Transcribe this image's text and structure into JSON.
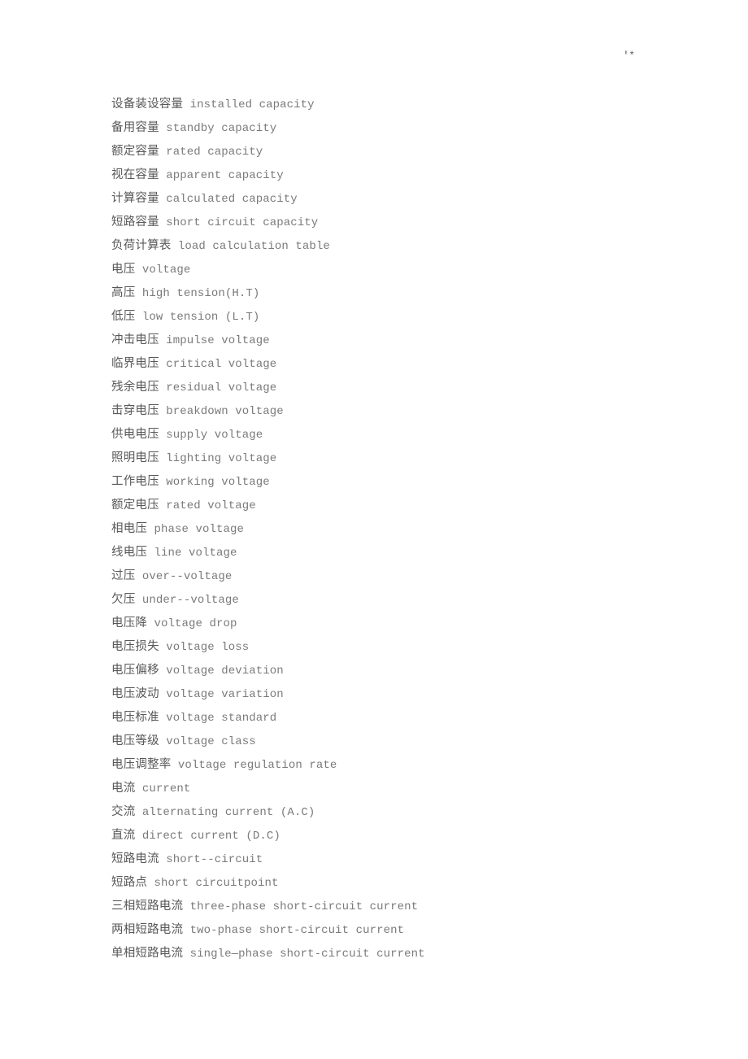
{
  "page": {
    "background_color": "#ffffff",
    "text_color": "#6b6b6b",
    "term_color": "#585858",
    "gloss_color": "#7a7a7a",
    "corner_mark": "'*"
  },
  "glossary": {
    "entries": [
      {
        "term": "设备装设容量",
        "gloss": "installed capacity"
      },
      {
        "term": "备用容量",
        "gloss": "standby capacity"
      },
      {
        "term": "额定容量",
        "gloss": "rated capacity"
      },
      {
        "term": "视在容量",
        "gloss": "apparent capacity"
      },
      {
        "term": "计算容量",
        "gloss": "calculated capacity"
      },
      {
        "term": "短路容量",
        "gloss": "short circuit capacity"
      },
      {
        "term": "负荷计算表",
        "gloss": "load calculation table"
      },
      {
        "term": "电压",
        "gloss": "voltage"
      },
      {
        "term": "高压",
        "gloss": "high tension(H.T)"
      },
      {
        "term": "低压",
        "gloss": "low tension (L.T)"
      },
      {
        "term": "冲击电压",
        "gloss": "impulse voltage"
      },
      {
        "term": "临界电压",
        "gloss": "critical voltage"
      },
      {
        "term": "残余电压",
        "gloss": "residual voltage"
      },
      {
        "term": "击穿电压",
        "gloss": "breakdown voltage"
      },
      {
        "term": "供电电压",
        "gloss": "supply voltage"
      },
      {
        "term": "照明电压",
        "gloss": "lighting voltage"
      },
      {
        "term": "工作电压",
        "gloss": "working voltage"
      },
      {
        "term": "额定电压",
        "gloss": "rated voltage"
      },
      {
        "term": "相电压",
        "gloss": "phase voltage"
      },
      {
        "term": "线电压",
        "gloss": "line voltage"
      },
      {
        "term": "过压",
        "gloss": "over--voltage"
      },
      {
        "term": "欠压",
        "gloss": "under--voltage"
      },
      {
        "term": "电压降",
        "gloss": "voltage drop"
      },
      {
        "term": "电压损失",
        "gloss": "voltage loss"
      },
      {
        "term": "电压偏移",
        "gloss": "voltage deviation"
      },
      {
        "term": "电压波动",
        "gloss": "voltage variation"
      },
      {
        "term": "电压标准",
        "gloss": "voltage standard"
      },
      {
        "term": "电压等级",
        "gloss": "voltage class"
      },
      {
        "term": "电压调整率",
        "gloss": "voltage regulation rate"
      },
      {
        "term": "电流",
        "gloss": "current"
      },
      {
        "term": "交流",
        "gloss": "alternating current (A.C)"
      },
      {
        "term": "直流",
        "gloss": "direct current (D.C)"
      },
      {
        "term": "短路电流",
        "gloss": "short--circuit"
      },
      {
        "term": "短路点",
        "gloss": "short circuitpoint"
      },
      {
        "term": "三相短路电流",
        "gloss": "three-phase short-circuit current"
      },
      {
        "term": "两相短路电流",
        "gloss": "two-phase short-circuit current"
      },
      {
        "term": "单相短路电流",
        "gloss": "single—phase short-circuit current"
      }
    ]
  }
}
